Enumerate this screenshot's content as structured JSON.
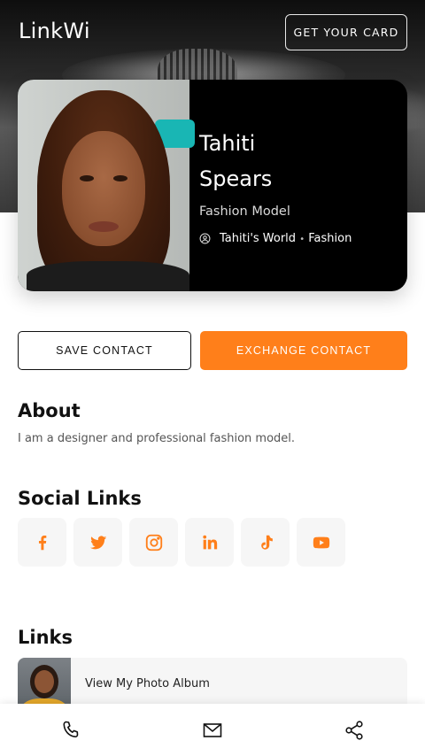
{
  "header": {
    "logo": "LinkWi",
    "cta_label": "GET YOUR CARD"
  },
  "profile": {
    "first_name": "Tahiti",
    "last_name": "Spears",
    "title": "Fashion Model",
    "company": "Tahiti's World",
    "separator": "•",
    "category": "Fashion"
  },
  "actions": {
    "save_label": "SAVE CONTACT",
    "exchange_label": "EXCHANGE CONTACT"
  },
  "about": {
    "heading": "About",
    "text": "I am a designer and professional fashion model."
  },
  "social": {
    "heading": "Social Links",
    "items": [
      {
        "icon": "facebook-icon"
      },
      {
        "icon": "twitter-icon"
      },
      {
        "icon": "instagram-icon"
      },
      {
        "icon": "linkedin-icon"
      },
      {
        "icon": "tiktok-icon"
      },
      {
        "icon": "youtube-icon"
      }
    ]
  },
  "links": {
    "heading": "Links",
    "items": [
      {
        "label": "View My Photo Album"
      }
    ]
  },
  "bottom_bar": {
    "items": [
      {
        "icon": "phone-icon"
      },
      {
        "icon": "mail-icon"
      },
      {
        "icon": "share-icon"
      }
    ]
  },
  "colors": {
    "accent": "#ff7f1a",
    "card_bg": "#000000",
    "social_bg": "#f6f6f6"
  }
}
